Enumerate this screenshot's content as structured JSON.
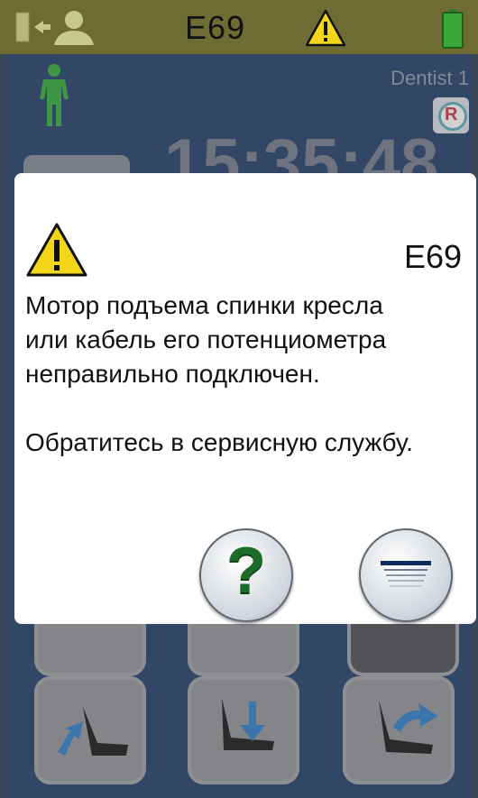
{
  "status_bar": {
    "error_code": "E69",
    "icons": [
      "patient-exit-icon",
      "warning-icon",
      "battery-icon"
    ]
  },
  "main": {
    "operator": "Dentist 1",
    "time": "15:35:48",
    "r_badge": "R",
    "icons": [
      "patient-standing-icon",
      "chair-backrest-down-icon",
      "chair-down-icon",
      "chair-backrest-up-icon"
    ]
  },
  "dialog": {
    "code": "E69",
    "message": "Мотор подъема спинки кресла\nили кабель его потенциометра\nнеправильно подключен.\n\nОбратитесь в сервисную службу.",
    "buttons": [
      "help-button",
      "menu-button"
    ],
    "help_label": "?"
  },
  "colors": {
    "status_bar": "#6f6c33",
    "background": "#0d2c5c",
    "help_green": "#1d6b27",
    "warning_yellow": "#f2d617"
  }
}
